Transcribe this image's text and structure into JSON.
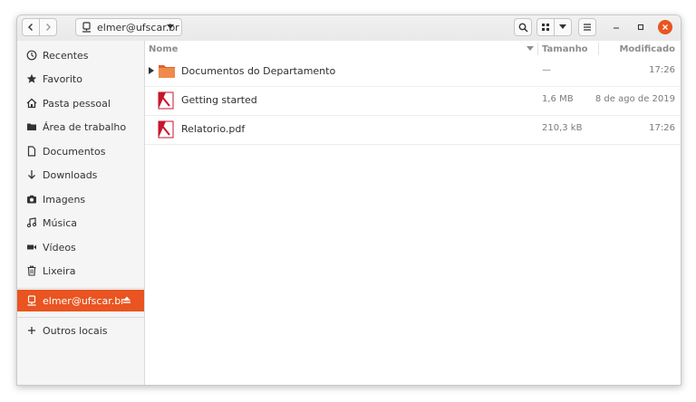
{
  "headerbar": {
    "path_label": "elmer@ufscar.br"
  },
  "sidebar": {
    "items": [
      {
        "label": "Recentes",
        "icon": "clock-icon"
      },
      {
        "label": "Favorito",
        "icon": "star-icon"
      },
      {
        "label": "Pasta pessoal",
        "icon": "home-icon"
      },
      {
        "label": "Área de trabalho",
        "icon": "folder-icon"
      },
      {
        "label": "Documentos",
        "icon": "document-icon"
      },
      {
        "label": "Downloads",
        "icon": "download-icon"
      },
      {
        "label": "Imagens",
        "icon": "camera-icon"
      },
      {
        "label": "Música",
        "icon": "music-icon"
      },
      {
        "label": "Vídeos",
        "icon": "video-icon"
      },
      {
        "label": "Lixeira",
        "icon": "trash-icon"
      }
    ],
    "active_mount": {
      "label": "elmer@ufscar.br",
      "icon": "network-drive-icon"
    },
    "other": {
      "label": "Outros locais",
      "icon": "plus-icon"
    }
  },
  "columns": {
    "name": "Nome",
    "size": "Tamanho",
    "modified": "Modificado"
  },
  "files": [
    {
      "name": "Documentos do Departamento",
      "size": "—",
      "modified": "17:26",
      "type": "folder"
    },
    {
      "name": "Getting started",
      "size": "1,6 MB",
      "modified": "8 de ago de 2019",
      "type": "pdf"
    },
    {
      "name": "Relatorio.pdf",
      "size": "210,3 kB",
      "modified": "17:26",
      "type": "pdf"
    }
  ],
  "colors": {
    "accent": "#e95420",
    "folder": "#f08a4b",
    "pdf": "#c7162b"
  }
}
